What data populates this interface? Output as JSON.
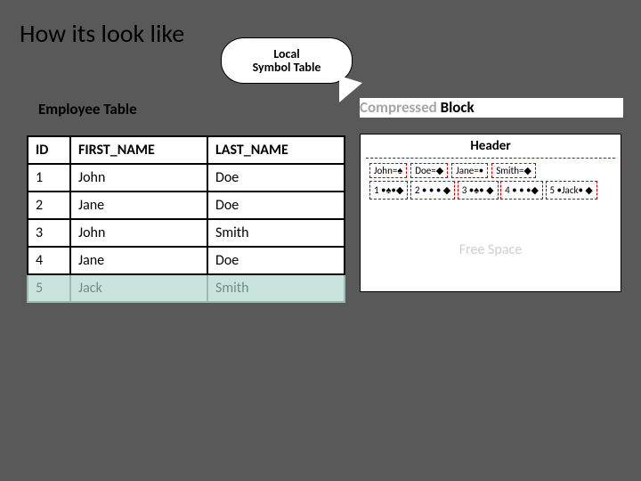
{
  "title": "How its look like",
  "bubble": "Local\nSymbol Table",
  "labels": {
    "employee": "Employee Table",
    "compressed_grey": "Compressed",
    "compressed_black": " Block"
  },
  "table": {
    "headers": [
      "ID",
      "FIRST_NAME",
      "LAST_NAME"
    ],
    "rows": [
      [
        "1",
        "John",
        "Doe"
      ],
      [
        "2",
        "Jane",
        "Doe"
      ],
      [
        "3",
        "John",
        "Smith"
      ],
      [
        "4",
        "Jane",
        "Doe"
      ],
      [
        "5",
        "Jack",
        "Smith"
      ]
    ],
    "highlighted_row_index": 4
  },
  "block": {
    "header": "Header",
    "symbols": [
      "John=♠",
      "Doe=◆",
      "Jane=•",
      "Smith=◆"
    ],
    "data": [
      "1 •♠•◆",
      "2 • • • ◆",
      "3 •♠• ◆",
      "4 • • •◆",
      "5 •Jack• ◆"
    ],
    "free": "Free Space"
  }
}
